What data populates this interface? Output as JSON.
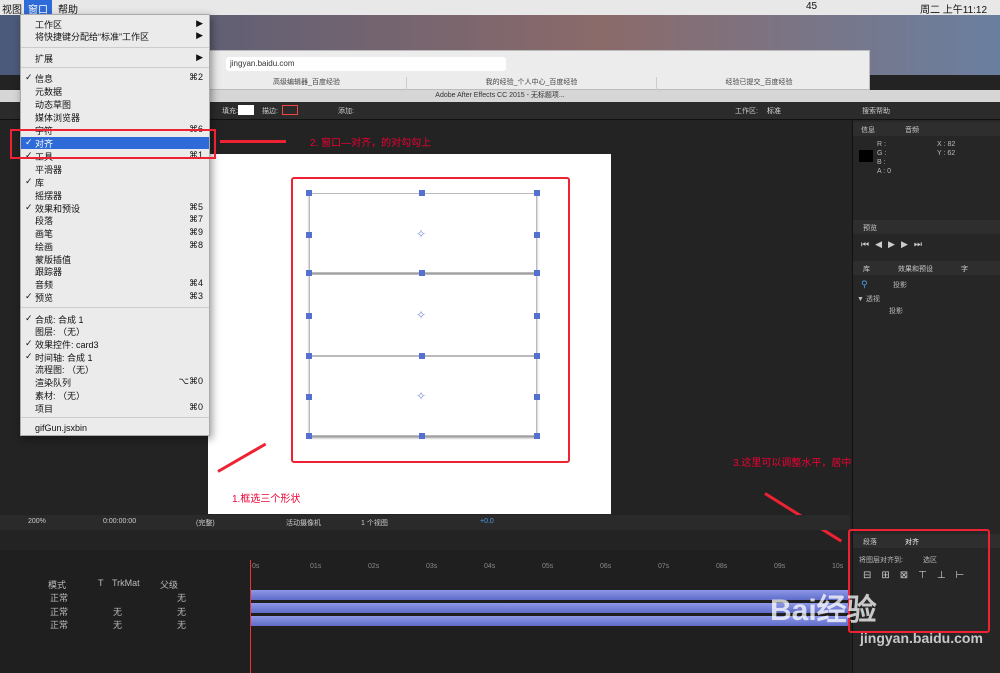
{
  "menubar": {
    "items": [
      "视图",
      "窗口",
      "帮助"
    ],
    "status": {
      "notif": "45",
      "clock": "周二 上午11:12"
    }
  },
  "browser": {
    "url": "jingyan.baidu.com",
    "tabs": [
      "高级编辑器_百度经验",
      "我的经验_个人中心_百度经验",
      "经验已提交_百度经验"
    ]
  },
  "ae": {
    "title": "Adobe After Effects CC 2015 - 无标题项...",
    "toolbar": {
      "fill": "填充:",
      "stroke": "描边:",
      "add": "添加:",
      "workspace_label": "工作区:",
      "workspace": "标准",
      "search": "搜索帮助"
    }
  },
  "menu": {
    "items": [
      {
        "label": "工作区",
        "check": false,
        "sc": "▶"
      },
      {
        "label": "将快捷键分配给“标准”工作区",
        "check": false,
        "sc": "▶"
      },
      {
        "label": "扩展",
        "check": false,
        "sc": "▶"
      },
      {
        "label": "信息",
        "check": true,
        "sc": "⌘2"
      },
      {
        "label": "元数据",
        "check": false,
        "sc": ""
      },
      {
        "label": "动态草图",
        "check": false,
        "sc": ""
      },
      {
        "label": "媒体浏览器",
        "check": false,
        "sc": ""
      },
      {
        "label": "字符",
        "check": false,
        "sc": "⌘6"
      },
      {
        "label": "对齐",
        "check": true,
        "sc": ""
      },
      {
        "label": "工具",
        "check": true,
        "sc": "⌘1"
      },
      {
        "label": "平滑器",
        "check": false,
        "sc": ""
      },
      {
        "label": "库",
        "check": true,
        "sc": ""
      },
      {
        "label": "摇摆器",
        "check": false,
        "sc": ""
      },
      {
        "label": "效果和预设",
        "check": true,
        "sc": "⌘5"
      },
      {
        "label": "段落",
        "check": false,
        "sc": "⌘7"
      },
      {
        "label": "画笔",
        "check": false,
        "sc": "⌘9"
      },
      {
        "label": "绘画",
        "check": false,
        "sc": "⌘8"
      },
      {
        "label": "蒙版插值",
        "check": false,
        "sc": ""
      },
      {
        "label": "跟踪器",
        "check": false,
        "sc": ""
      },
      {
        "label": "音频",
        "check": false,
        "sc": "⌘4"
      },
      {
        "label": "预览",
        "check": true,
        "sc": "⌘3"
      },
      {
        "label": "合成: 合成 1",
        "check": true,
        "sc": ""
      },
      {
        "label": "图层: （无）",
        "check": false,
        "sc": ""
      },
      {
        "label": "效果控件: card3",
        "check": true,
        "sc": ""
      },
      {
        "label": "时间轴: 合成 1",
        "check": true,
        "sc": ""
      },
      {
        "label": "流程图: （无）",
        "check": false,
        "sc": ""
      },
      {
        "label": "渲染队列",
        "check": false,
        "sc": "⌥⌘0"
      },
      {
        "label": "素材: （无）",
        "check": false,
        "sc": ""
      },
      {
        "label": "项目",
        "check": false,
        "sc": "⌘0"
      },
      {
        "label": "gifGun.jsxbin",
        "check": false,
        "sc": ""
      }
    ],
    "checkmark": "✓"
  },
  "annotations": {
    "a1": "1.框选三个形状",
    "a2": "2. 窗口—对齐，的对勾勾上",
    "a3": "3.这里可以调整水平，居中对齐，跟ps一样"
  },
  "info": {
    "tabs": [
      "信息",
      "音频"
    ],
    "r": "R :",
    "g": "G :",
    "b": "B :",
    "a": "A : 0",
    "x": "X : 82",
    "y": "Y : 62"
  },
  "preview": {
    "title": "预览"
  },
  "effects": {
    "tabs": [
      "库",
      "效果和预设",
      "字"
    ],
    "search": "投影",
    "category": "▼ 透视",
    "item": "投影"
  },
  "align": {
    "tabs": [
      "段落",
      "对齐"
    ],
    "align_to_label": "将图层对齐到:",
    "align_to_value": "选区"
  },
  "compfoot": {
    "zoom": "200%",
    "time": "0:00:00:00",
    "quality": "(完整)",
    "camera": "活动摄像机",
    "views": "1 个视图",
    "offset": "+0.0"
  },
  "timeline": {
    "cols": [
      "模式",
      "T",
      "TrkMat",
      "父级"
    ],
    "rows": [
      {
        "mode": "正常",
        "trk": "",
        "parent": "无"
      },
      {
        "mode": "正常",
        "trk": "无",
        "parent": "无"
      },
      {
        "mode": "正常",
        "trk": "无",
        "parent": "无"
      }
    ],
    "ticks": [
      "0s",
      "01s",
      "02s",
      "03s",
      "04s",
      "05s",
      "06s",
      "07s",
      "08s",
      "09s",
      "10s"
    ]
  },
  "watermark": {
    "brand": "Bai经验",
    "url": "jingyan.baidu.com"
  }
}
